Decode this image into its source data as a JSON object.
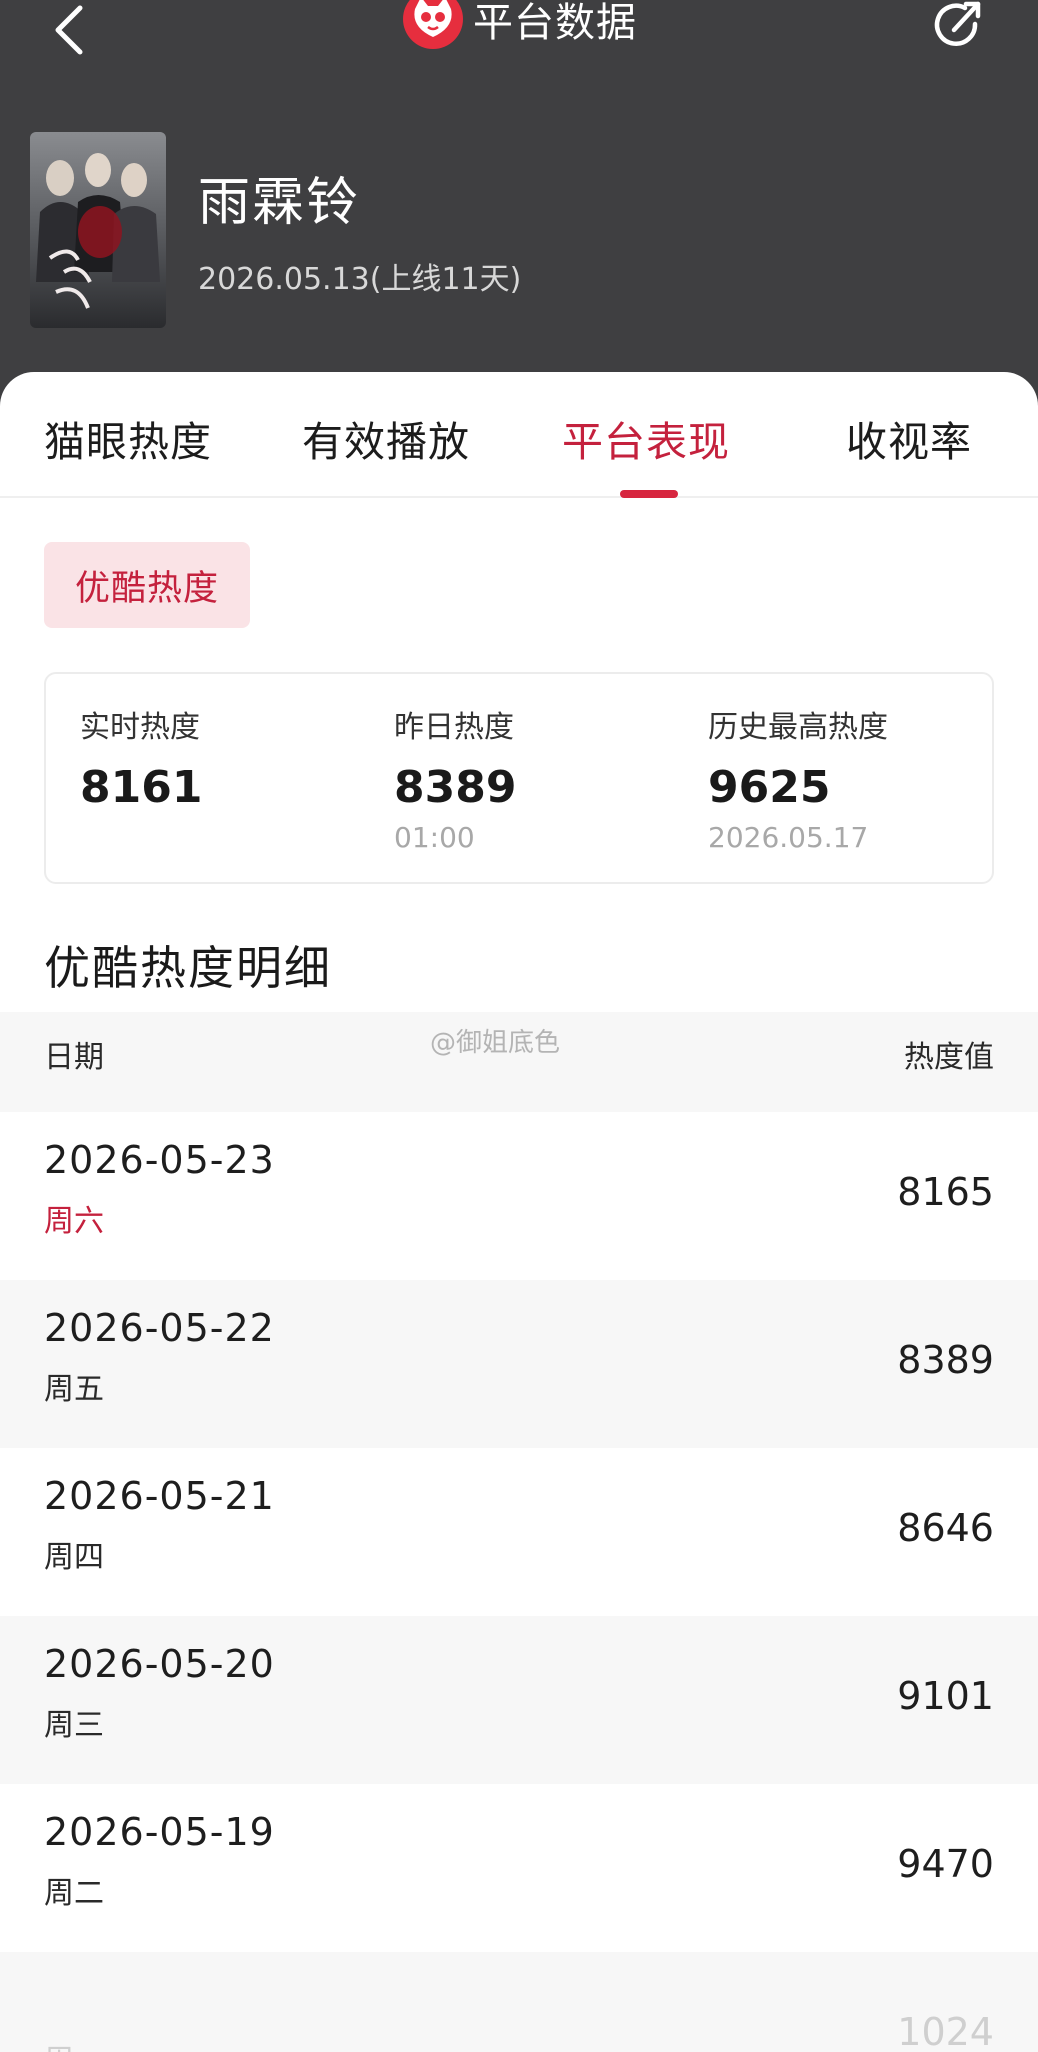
{
  "header": {
    "title": "平台数据"
  },
  "show": {
    "name": "雨霖铃",
    "release_info": "2026.05.13(上线11天)"
  },
  "tabs": [
    {
      "label": "猫眼热度",
      "active": false
    },
    {
      "label": "有效播放",
      "active": false
    },
    {
      "label": "平台表现",
      "active": true
    },
    {
      "label": "收视率",
      "active": false
    }
  ],
  "platform_chip": "优酷热度",
  "stats": {
    "realtime": {
      "label": "实时热度",
      "value": "8161"
    },
    "yesterday": {
      "label": "昨日热度",
      "value": "8389",
      "sub": "01:00"
    },
    "peak": {
      "label": "历史最高热度",
      "value": "9625",
      "sub": "2026.05.17"
    }
  },
  "section_title": "优酷热度明细",
  "table": {
    "col_date": "日期",
    "col_value": "热度值",
    "watermark": "@御姐底色",
    "rows": [
      {
        "date": "2026-05-23",
        "weekday": "周六",
        "value": "8165"
      },
      {
        "date": "2026-05-22",
        "weekday": "周五",
        "value": "8389"
      },
      {
        "date": "2026-05-21",
        "weekday": "周四",
        "value": "8646"
      },
      {
        "date": "2026-05-20",
        "weekday": "周三",
        "value": "9101"
      },
      {
        "date": "2026-05-19",
        "weekday": "周二",
        "value": "9470"
      },
      {
        "date": "",
        "weekday": "周一",
        "value": "1024"
      }
    ]
  },
  "colors": {
    "accent": "#c4213d",
    "header_bg": "#3f3f41",
    "chip_bg": "#fae3e6"
  }
}
